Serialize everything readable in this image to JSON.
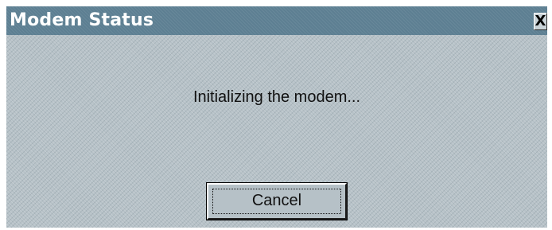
{
  "window": {
    "title": "Modem Status",
    "close_label": "X"
  },
  "message": "Initializing the modem...",
  "buttons": {
    "cancel_label": "Cancel"
  },
  "colors": {
    "titlebar": "#5d7f92",
    "dialog_bg": "#b6c1c7",
    "text": "#111111"
  },
  "icons": {
    "close": "close-icon"
  }
}
